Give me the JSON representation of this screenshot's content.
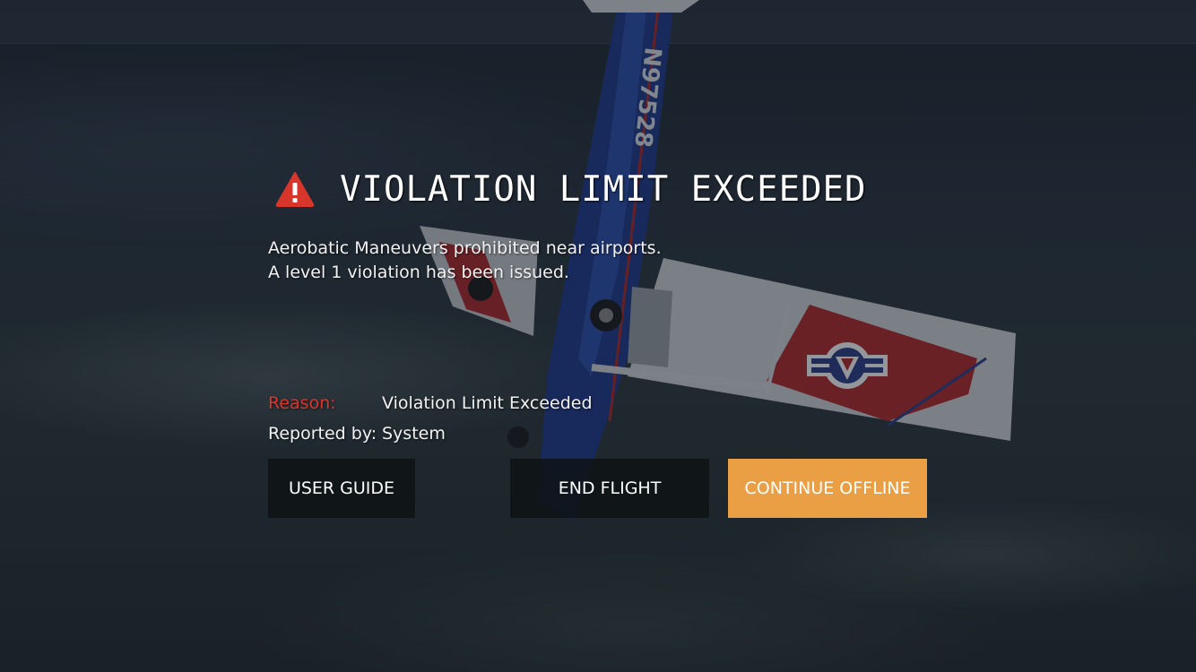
{
  "dialog": {
    "icon": "warning-triangle-icon",
    "title": "VIOLATION LIMIT EXCEEDED",
    "message_line1": "Aerobatic Maneuvers prohibited near airports.",
    "message_line2": "A level 1 violation has been issued.",
    "reason_label": "Reason:",
    "reason_value": "Violation Limit Exceeded",
    "reported_label": "Reported by:",
    "reported_value": "System"
  },
  "buttons": {
    "user_guide": "USER GUIDE",
    "end_flight": "END FLIGHT",
    "continue_offline": "CONTINUE OFFLINE"
  },
  "aircraft": {
    "registration": "N97528"
  },
  "colors": {
    "accent_warning": "#d9362b",
    "primary_button": "#eb9f44",
    "secondary_button": "#0e1214"
  }
}
